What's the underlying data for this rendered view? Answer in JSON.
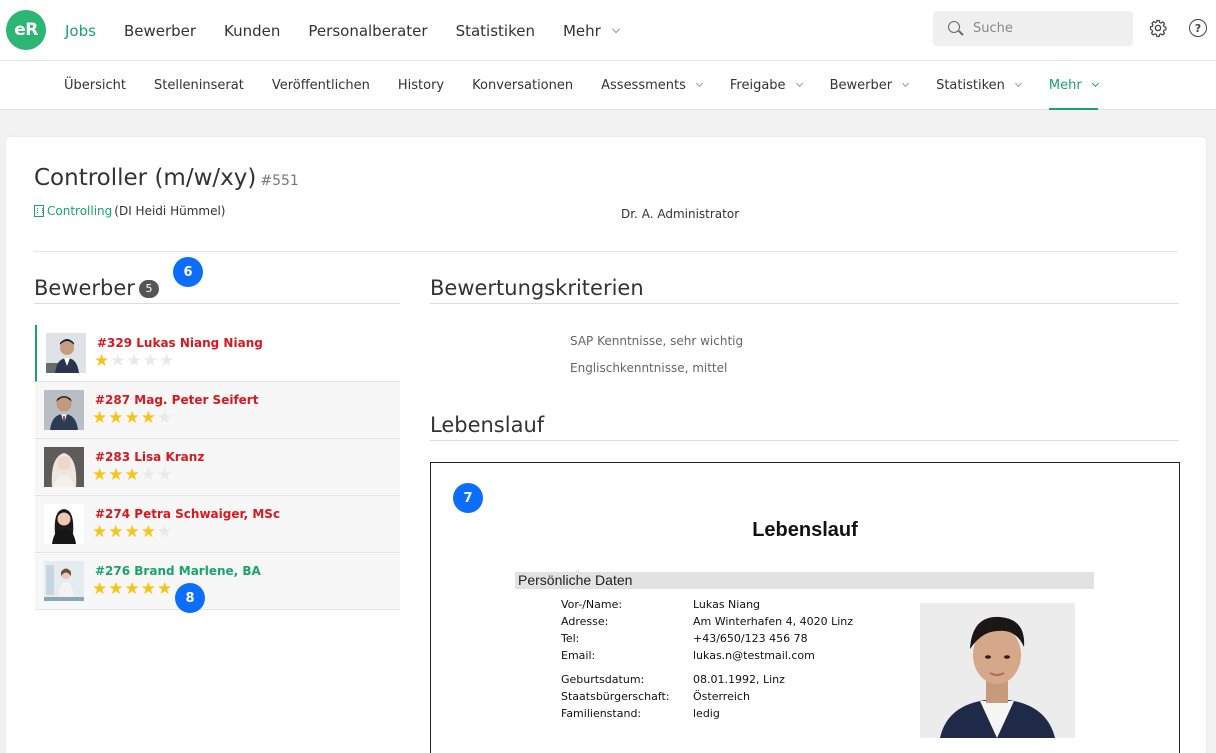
{
  "brand": {
    "logo_text": "eR",
    "accent": "#1aa36b"
  },
  "topnav": {
    "items": [
      {
        "label": "Jobs",
        "active": true
      },
      {
        "label": "Bewerber"
      },
      {
        "label": "Kunden"
      },
      {
        "label": "Personalberater"
      },
      {
        "label": "Statistiken"
      },
      {
        "label": "Mehr",
        "dropdown": true
      }
    ],
    "search_placeholder": "Suche",
    "settings_icon": "gear-icon",
    "help_icon": "help-icon",
    "help_glyph": "?"
  },
  "subnav": {
    "items": [
      {
        "label": "Übersicht"
      },
      {
        "label": "Stelleninserat"
      },
      {
        "label": "Veröffentlichen"
      },
      {
        "label": "History"
      },
      {
        "label": "Konversationen"
      },
      {
        "label": "Assessments",
        "dropdown": true
      },
      {
        "label": "Freigabe",
        "dropdown": true
      },
      {
        "label": "Bewerber",
        "dropdown": true
      },
      {
        "label": "Statistiken",
        "dropdown": true
      },
      {
        "label": "Mehr",
        "dropdown": true,
        "active": true
      }
    ]
  },
  "job": {
    "title": "Controller (m/w/xy)",
    "id": "#551",
    "department": "Controlling",
    "manager": "(DI Heidi Hümmel)",
    "admin": "Dr. A. Administrator"
  },
  "applicants": {
    "title": "Bewerber",
    "count": "5",
    "list": [
      {
        "name": "#329 Lukas Niang Niang",
        "rating": 1,
        "selected": true,
        "color": "red"
      },
      {
        "name": "#287 Mag. Peter Seifert",
        "rating": 4,
        "color": "red"
      },
      {
        "name": "#283 Lisa Kranz",
        "rating": 3,
        "color": "red"
      },
      {
        "name": "#274 Petra Schwaiger, MSc",
        "rating": 4,
        "color": "red"
      },
      {
        "name": "#276 Brand Marlene, BA",
        "rating": 5,
        "color": "green"
      }
    ]
  },
  "criteria": {
    "title": "Bewertungskriterien",
    "items": [
      "SAP Kenntnisse, sehr wichtig",
      "Englischkenntnisse, mittel"
    ]
  },
  "cv": {
    "section_title": "Lebenslauf",
    "doc_title": "Lebenslauf",
    "personal_header": "Persönliche Daten",
    "rows": [
      {
        "label": "Vor-/Name:",
        "value": "Lukas Niang"
      },
      {
        "label": "Adresse:",
        "value": "Am Winterhafen 4, 4020 Linz"
      },
      {
        "label": "Tel:",
        "value": "+43/650/123 456 78"
      },
      {
        "label": "Email:",
        "value": "lukas.n@testmail.com"
      },
      {
        "label": "Geburtsdatum:",
        "value": "08.01.1992, Linz"
      },
      {
        "label": "Staatsbürgerschaft:",
        "value": "Österreich"
      },
      {
        "label": "Familienstand:",
        "value": "ledig"
      }
    ]
  },
  "markers": {
    "m6": "6",
    "m7": "7",
    "m8": "8"
  }
}
